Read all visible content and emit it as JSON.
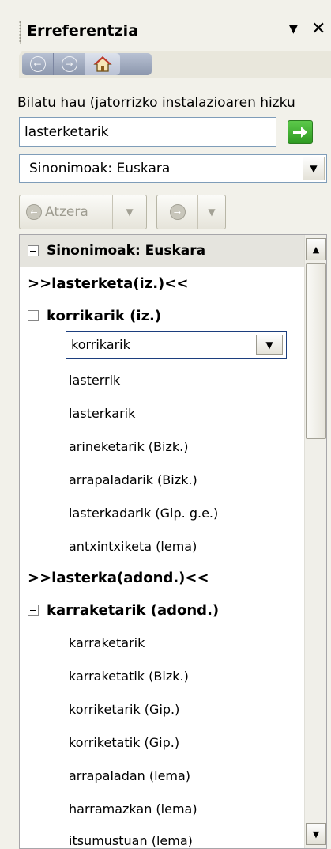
{
  "pane": {
    "title": "Erreferentzia",
    "menu_icon": "▼",
    "close_icon": "✕"
  },
  "nav": {
    "back_icon": "back-arrow-icon",
    "forward_icon": "forward-arrow-icon",
    "home_icon": "home-icon"
  },
  "search": {
    "label": "Bilatu hau (jatorrizko instalazioaren hizku",
    "value": "lasterketarik"
  },
  "source_select": {
    "selected": "Sinonimoak: Euskara"
  },
  "history": {
    "back_label": "Atzera"
  },
  "results": {
    "section_title": "Sinonimoak: Euskara",
    "entries": [
      {
        "kind": "main",
        "text": ">>lasterketa(iz.)<<"
      },
      {
        "kind": "group",
        "text": "korrikarik (iz.)"
      },
      {
        "kind": "combo",
        "text": "korrikarik"
      },
      {
        "kind": "item",
        "text": "lasterrik"
      },
      {
        "kind": "item",
        "text": "lasterkarik"
      },
      {
        "kind": "item",
        "text": "arineketarik (Bizk.)"
      },
      {
        "kind": "item",
        "text": "arrapaladarik (Bizk.)"
      },
      {
        "kind": "item",
        "text": "lasterkadarik (Gip. g.e.)"
      },
      {
        "kind": "item",
        "text": "antxintxiketa (lema)"
      },
      {
        "kind": "main",
        "text": ">>lasterka(adond.)<<"
      },
      {
        "kind": "group",
        "text": "karraketarik (adond.)"
      },
      {
        "kind": "item",
        "text": "karraketarik"
      },
      {
        "kind": "item",
        "text": "karraketatik (Bizk.)"
      },
      {
        "kind": "item",
        "text": "korriketarik (Gip.)"
      },
      {
        "kind": "item",
        "text": "korriketatik (Gip.)"
      },
      {
        "kind": "item",
        "text": "arrapaladan (lema)"
      },
      {
        "kind": "item",
        "text": "harramazkan (lema)"
      },
      {
        "kind": "item",
        "text": "itsumustuan (lema)"
      }
    ]
  },
  "colors": {
    "pane_bg": "#f2f1ea",
    "section_bg": "#e5e4de",
    "go_green": "#2e9a22",
    "combo_border": "#1c3e7e"
  }
}
